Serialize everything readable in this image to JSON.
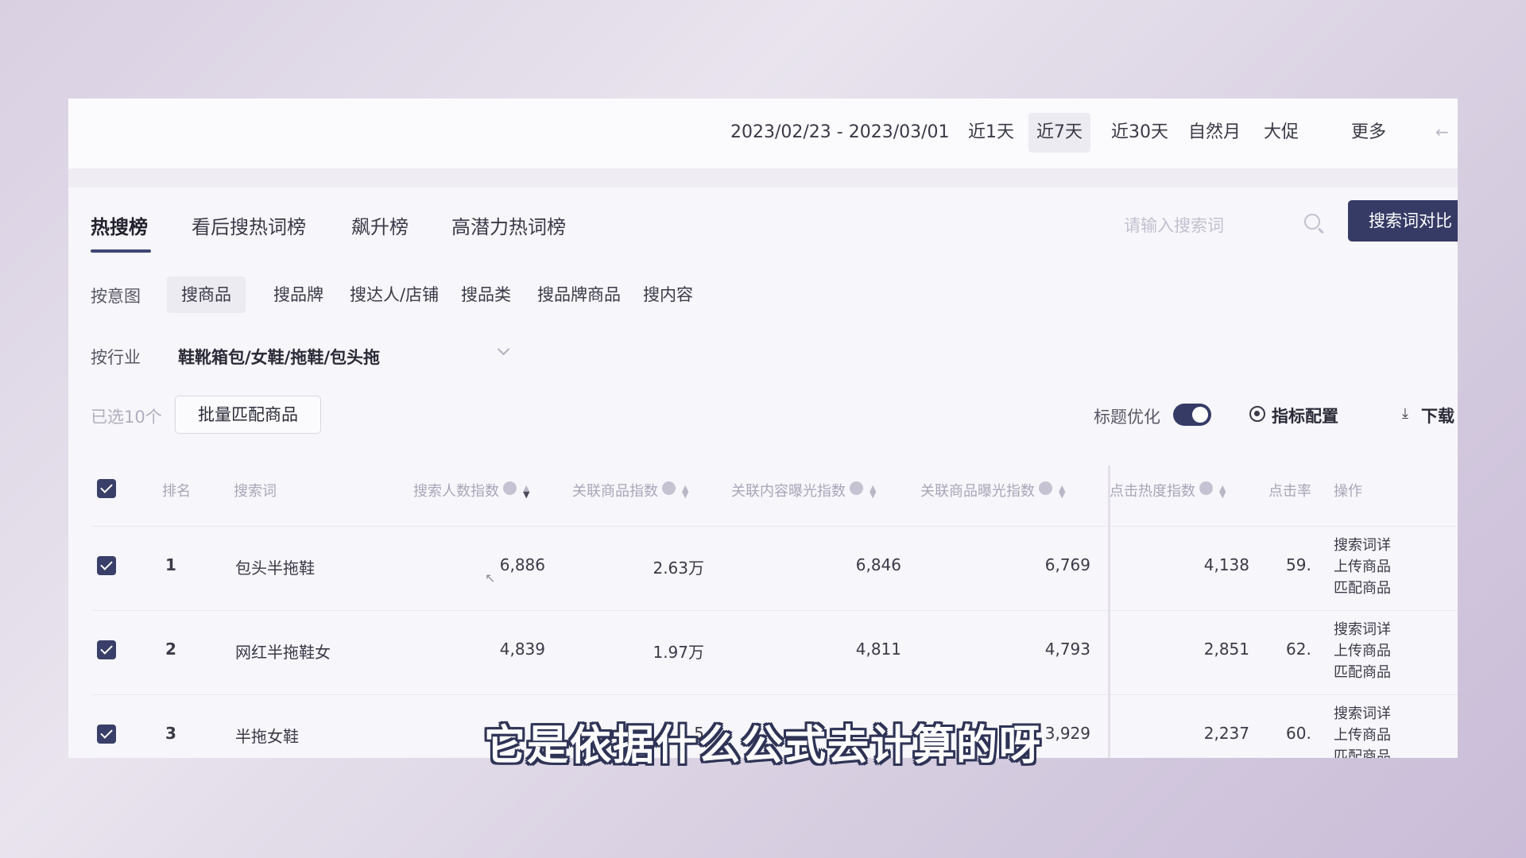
{
  "date_bar": {
    "range": "2023/02/23 - 2023/03/01",
    "periods": [
      {
        "label": "近1天",
        "active": false
      },
      {
        "label": "近7天",
        "active": true
      },
      {
        "label": "近30天",
        "active": false
      },
      {
        "label": "自然月",
        "active": false
      },
      {
        "label": "大促",
        "active": false
      },
      {
        "label": "更多",
        "active": false
      }
    ],
    "back_glyph": "←"
  },
  "tabs": [
    {
      "label": "热搜榜",
      "active": true
    },
    {
      "label": "看后搜热词榜",
      "active": false
    },
    {
      "label": "飙升榜",
      "active": false
    },
    {
      "label": "高潜力热词榜",
      "active": false
    }
  ],
  "search": {
    "placeholder": "请输入搜索词",
    "compare_button": "搜索词对比"
  },
  "filters": {
    "intent_label": "按意图",
    "intents": [
      {
        "label": "搜商品",
        "active": true
      },
      {
        "label": "搜品牌",
        "active": false
      },
      {
        "label": "搜达人/店铺",
        "active": false
      },
      {
        "label": "搜品类",
        "active": false
      },
      {
        "label": "搜品牌商品",
        "active": false
      },
      {
        "label": "搜内容",
        "active": false
      }
    ],
    "industry_label": "按行业",
    "industry_value": "鞋靴箱包/女鞋/拖鞋/包头拖"
  },
  "toolbar": {
    "selected_text": "已选10个",
    "batch_button": "批量匹配商品",
    "title_opt_label": "标题优化",
    "title_opt_on": true,
    "metric_config": "指标配置",
    "download": "下载",
    "download_glyph": "⤓"
  },
  "table": {
    "headers": {
      "rank": "排名",
      "keyword": "搜索词",
      "search_people": "搜索人数指数",
      "related_goods": "关联商品指数",
      "content_exposure": "关联内容曝光指数",
      "goods_exposure": "关联商品曝光指数",
      "click_heat": "点击热度指数",
      "ctr": "点击率",
      "ops": "操作"
    },
    "help_glyph": "?",
    "rows": [
      {
        "rank": "1",
        "keyword": "包头半拖鞋",
        "search_people": "6,886",
        "related_goods": "2.63万",
        "content_exposure": "6,846",
        "goods_exposure": "6,769",
        "click_heat": "4,138",
        "ctr": "59.",
        "ops": [
          "搜索词详",
          "上传商品",
          "匹配商品"
        ]
      },
      {
        "rank": "2",
        "keyword": "网红半拖鞋女",
        "search_people": "4,839",
        "related_goods": "1.97万",
        "content_exposure": "4,811",
        "goods_exposure": "4,793",
        "click_heat": "2,851",
        "ctr": "62.",
        "ops": [
          "搜索词详",
          "上传商品",
          "匹配商品"
        ]
      },
      {
        "rank": "3",
        "keyword": "半拖女鞋",
        "search_people": "",
        "related_goods": "1.5",
        "content_exposure": "",
        "goods_exposure": "3,929",
        "click_heat": "2,237",
        "ctr": "60.",
        "ops": [
          "搜索词详",
          "上传商品",
          "匹配商品"
        ]
      }
    ]
  },
  "cursor_glyph": "↖",
  "subtitle": "它是依据什么公式去计算的呀"
}
